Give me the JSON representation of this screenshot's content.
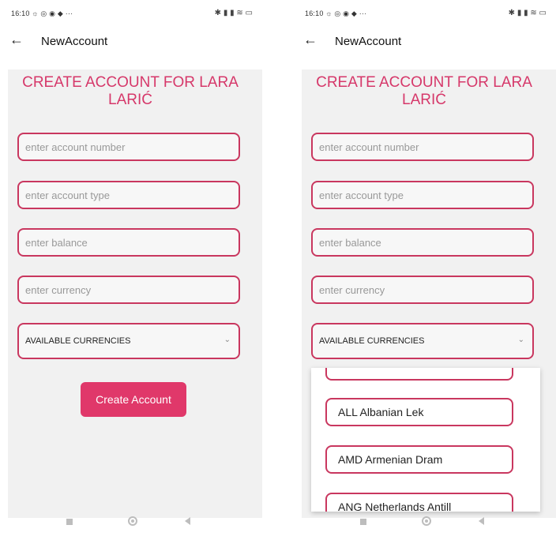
{
  "status_bar": {
    "time": "16:10",
    "left_icons": "☼ ◎ ◉ ◆ ···",
    "right_icons": "✱ ▮ ▮ ≋ ▭"
  },
  "app_bar": {
    "title": "NewAccount"
  },
  "heading": "CREATE ACCOUNT FOR LARA LARIĆ",
  "fields": {
    "account_number": {
      "placeholder": "enter account number",
      "value": ""
    },
    "account_type": {
      "placeholder": "enter account type",
      "value": ""
    },
    "balance": {
      "placeholder": "enter balance",
      "value": ""
    },
    "currency": {
      "placeholder": "enter currency",
      "value": ""
    }
  },
  "currency_select": {
    "label": "AVAILABLE CURRENCIES"
  },
  "create_button": {
    "label": "Create Account"
  },
  "currency_options": [
    "",
    "ALL Albanian Lek",
    "AMD Armenian Dram",
    "ANG Netherlands Antill"
  ],
  "colors": {
    "accent": "#e0386a",
    "border": "#c9375f",
    "background": "#f1f1f1"
  },
  "icons": {
    "back": "arrow-left",
    "chevron": "chevron-down",
    "nav": [
      "square",
      "circle",
      "triangle-left"
    ]
  }
}
